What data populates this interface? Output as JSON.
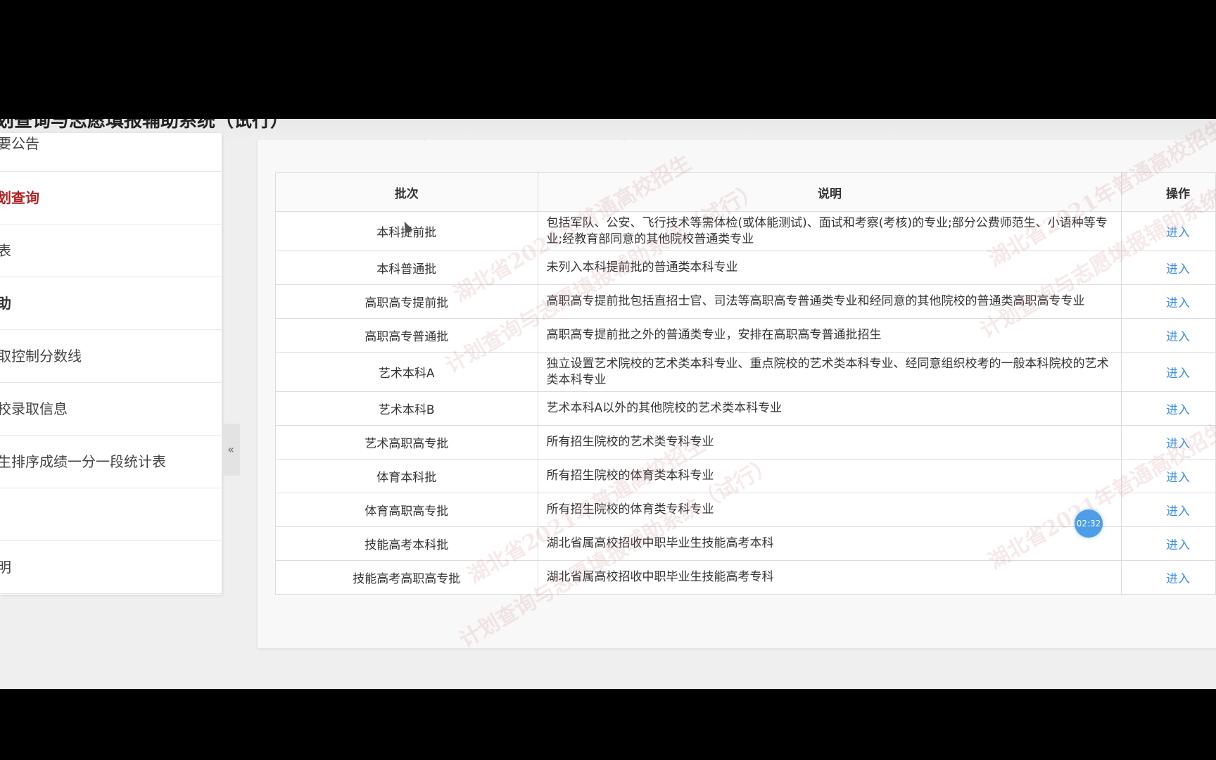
{
  "app": {
    "title": "划查询与志愿填报辅助系统（试行）",
    "content_title": "计划查询与志愿填报辅助系统（试行）"
  },
  "sidebar": {
    "items": [
      {
        "label": "要公告",
        "state": "normal"
      },
      {
        "label": "划查询",
        "state": "active"
      },
      {
        "label": "表",
        "state": "normal"
      },
      {
        "label": "助",
        "state": "bold"
      },
      {
        "label": "取控制分数线",
        "state": "normal"
      },
      {
        "label": "校录取信息",
        "state": "normal"
      },
      {
        "label": "生排序成绩一分一段统计表",
        "state": "normal"
      },
      {
        "label": "",
        "state": "normal"
      },
      {
        "label": "明",
        "state": "normal"
      }
    ],
    "collapse_icon": "«"
  },
  "table": {
    "headers": {
      "batch": "批次",
      "desc": "说明",
      "op": "操作"
    },
    "rows": [
      {
        "batch": "本科提前批",
        "desc": "包括军队、公安、飞行技术等需体检(或体能测试)、面试和考察(考核)的专业;部分公费师范生、小语种等专业;经教育部同意的其他院校普通类专业",
        "op": "进入"
      },
      {
        "batch": "本科普通批",
        "desc": "未列入本科提前批的普通类本科专业",
        "op": "进入"
      },
      {
        "batch": "高职高专提前批",
        "desc": "高职高专提前批包括直招士官、司法等高职高专普通类专业和经同意的其他院校的普通类高职高专专业",
        "op": "进入"
      },
      {
        "batch": "高职高专普通批",
        "desc": "高职高专提前批之外的普通类专业，安排在高职高专普通批招生",
        "op": "进入"
      },
      {
        "batch": "艺术本科A",
        "desc": "独立设置艺术院校的艺术类本科专业、重点院校的艺术类本科专业、经同意组织校考的一般本科院校的艺术类本科专业",
        "op": "进入"
      },
      {
        "batch": "艺术本科B",
        "desc": "艺术本科A以外的其他院校的艺术类本科专业",
        "op": "进入"
      },
      {
        "batch": "艺术高职高专批",
        "desc": "所有招生院校的艺术类专科专业",
        "op": "进入"
      },
      {
        "batch": "体育本科批",
        "desc": "所有招生院校的体育类本科专业",
        "op": "进入"
      },
      {
        "batch": "体育高职高专批",
        "desc": "所有招生院校的体育类专科专业",
        "op": "进入"
      },
      {
        "batch": "技能高考本科批",
        "desc": "湖北省属高校招收中职毕业生技能高考本科",
        "op": "进入"
      },
      {
        "batch": "技能高考高职高专批",
        "desc": "湖北省属高校招收中职毕业生技能高考专科",
        "op": "进入"
      }
    ]
  },
  "watermark": {
    "line1": "湖北省2021年普通高校招生",
    "line2": "计划查询与志愿填报辅助系统（试行）"
  },
  "timer": "02:32"
}
